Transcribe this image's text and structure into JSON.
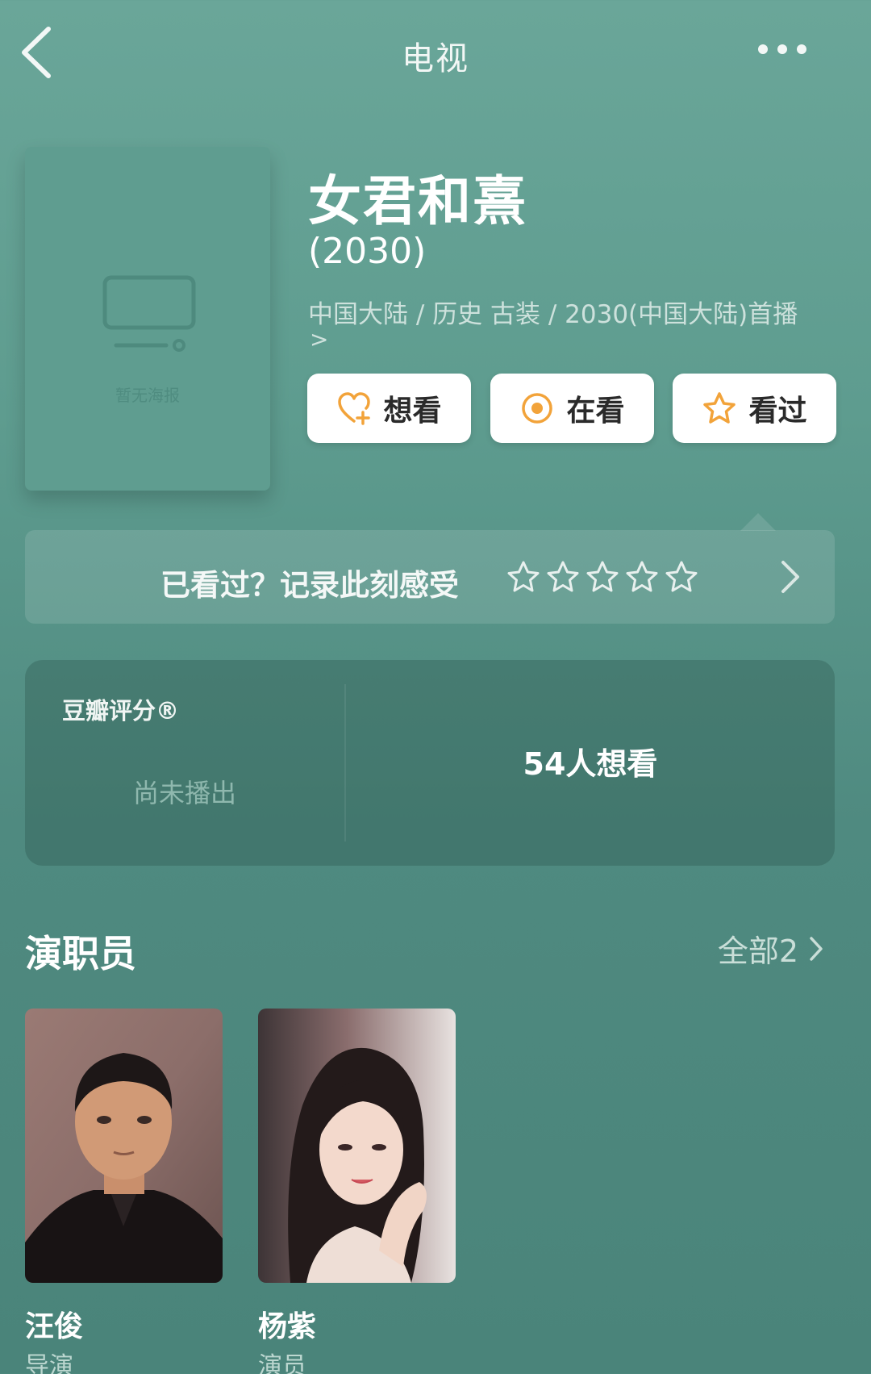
{
  "header": {
    "title": "电视"
  },
  "poster": {
    "caption": "暂无海报"
  },
  "show": {
    "title": "女君和熹",
    "year": "(2030)",
    "meta": "中国大陆 / 历史 古装 / 2030(中国大陆)首播",
    "meta_arrow": ">"
  },
  "actions": {
    "want": "想看",
    "watching": "在看",
    "watched": "看过"
  },
  "rating_prompt": {
    "text": "已看过？记录此刻感受",
    "stars": 5
  },
  "score": {
    "label": "豆瓣评分®",
    "status": "尚未播出",
    "want_count": "54人想看"
  },
  "cast": {
    "heading": "演职员",
    "all_label": "全部2",
    "members": [
      {
        "name": "汪俊",
        "role": "导演"
      },
      {
        "name": "杨紫",
        "role": "演员"
      }
    ]
  },
  "colors": {
    "background": "#5e9c8f",
    "accent_orange": "#f2a33a",
    "button_bg": "#ffffff"
  }
}
